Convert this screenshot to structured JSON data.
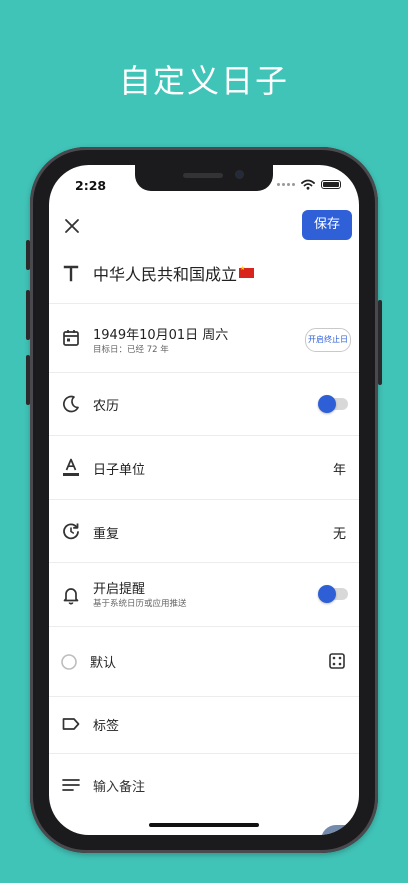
{
  "headline": "自定义日子",
  "status_bar": {
    "time": "2:28"
  },
  "toolbar": {
    "save_label": "保存"
  },
  "event": {
    "title": "中华人民共和国成立"
  },
  "date": {
    "main": "1949年10月01日 周六",
    "sub": "目标日：已经 72 年",
    "end_date_button": "开启终止日"
  },
  "lunar": {
    "label": "农历",
    "enabled": true
  },
  "unit": {
    "label": "日子单位",
    "value": "年"
  },
  "repeat": {
    "label": "重复",
    "value": "无"
  },
  "reminder": {
    "label": "开启提醒",
    "sub": "基于系统日历或应用推送",
    "enabled": true
  },
  "category": {
    "label": "默认"
  },
  "tags": {
    "label": "标签"
  },
  "notes": {
    "placeholder": "输入备注"
  },
  "icons": [
    "close-icon",
    "title-t-icon",
    "calendar-icon",
    "moon-icon",
    "text-format-icon",
    "repeat-icon",
    "bell-icon",
    "circle-icon",
    "dice-icon",
    "tag-icon",
    "notes-icon"
  ],
  "colors": {
    "background": "#41c4b8",
    "accent": "#2f60d8"
  }
}
